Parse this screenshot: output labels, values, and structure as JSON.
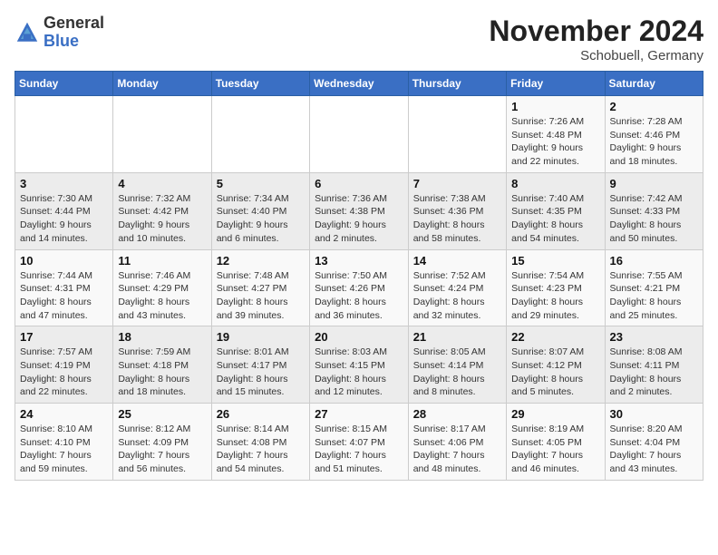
{
  "header": {
    "logo_general": "General",
    "logo_blue": "Blue",
    "month_title": "November 2024",
    "subtitle": "Schobuell, Germany"
  },
  "days_of_week": [
    "Sunday",
    "Monday",
    "Tuesday",
    "Wednesday",
    "Thursday",
    "Friday",
    "Saturday"
  ],
  "weeks": [
    [
      {
        "day": "",
        "info": ""
      },
      {
        "day": "",
        "info": ""
      },
      {
        "day": "",
        "info": ""
      },
      {
        "day": "",
        "info": ""
      },
      {
        "day": "",
        "info": ""
      },
      {
        "day": "1",
        "info": "Sunrise: 7:26 AM\nSunset: 4:48 PM\nDaylight: 9 hours\nand 22 minutes."
      },
      {
        "day": "2",
        "info": "Sunrise: 7:28 AM\nSunset: 4:46 PM\nDaylight: 9 hours\nand 18 minutes."
      }
    ],
    [
      {
        "day": "3",
        "info": "Sunrise: 7:30 AM\nSunset: 4:44 PM\nDaylight: 9 hours\nand 14 minutes."
      },
      {
        "day": "4",
        "info": "Sunrise: 7:32 AM\nSunset: 4:42 PM\nDaylight: 9 hours\nand 10 minutes."
      },
      {
        "day": "5",
        "info": "Sunrise: 7:34 AM\nSunset: 4:40 PM\nDaylight: 9 hours\nand 6 minutes."
      },
      {
        "day": "6",
        "info": "Sunrise: 7:36 AM\nSunset: 4:38 PM\nDaylight: 9 hours\nand 2 minutes."
      },
      {
        "day": "7",
        "info": "Sunrise: 7:38 AM\nSunset: 4:36 PM\nDaylight: 8 hours\nand 58 minutes."
      },
      {
        "day": "8",
        "info": "Sunrise: 7:40 AM\nSunset: 4:35 PM\nDaylight: 8 hours\nand 54 minutes."
      },
      {
        "day": "9",
        "info": "Sunrise: 7:42 AM\nSunset: 4:33 PM\nDaylight: 8 hours\nand 50 minutes."
      }
    ],
    [
      {
        "day": "10",
        "info": "Sunrise: 7:44 AM\nSunset: 4:31 PM\nDaylight: 8 hours\nand 47 minutes."
      },
      {
        "day": "11",
        "info": "Sunrise: 7:46 AM\nSunset: 4:29 PM\nDaylight: 8 hours\nand 43 minutes."
      },
      {
        "day": "12",
        "info": "Sunrise: 7:48 AM\nSunset: 4:27 PM\nDaylight: 8 hours\nand 39 minutes."
      },
      {
        "day": "13",
        "info": "Sunrise: 7:50 AM\nSunset: 4:26 PM\nDaylight: 8 hours\nand 36 minutes."
      },
      {
        "day": "14",
        "info": "Sunrise: 7:52 AM\nSunset: 4:24 PM\nDaylight: 8 hours\nand 32 minutes."
      },
      {
        "day": "15",
        "info": "Sunrise: 7:54 AM\nSunset: 4:23 PM\nDaylight: 8 hours\nand 29 minutes."
      },
      {
        "day": "16",
        "info": "Sunrise: 7:55 AM\nSunset: 4:21 PM\nDaylight: 8 hours\nand 25 minutes."
      }
    ],
    [
      {
        "day": "17",
        "info": "Sunrise: 7:57 AM\nSunset: 4:19 PM\nDaylight: 8 hours\nand 22 minutes."
      },
      {
        "day": "18",
        "info": "Sunrise: 7:59 AM\nSunset: 4:18 PM\nDaylight: 8 hours\nand 18 minutes."
      },
      {
        "day": "19",
        "info": "Sunrise: 8:01 AM\nSunset: 4:17 PM\nDaylight: 8 hours\nand 15 minutes."
      },
      {
        "day": "20",
        "info": "Sunrise: 8:03 AM\nSunset: 4:15 PM\nDaylight: 8 hours\nand 12 minutes."
      },
      {
        "day": "21",
        "info": "Sunrise: 8:05 AM\nSunset: 4:14 PM\nDaylight: 8 hours\nand 8 minutes."
      },
      {
        "day": "22",
        "info": "Sunrise: 8:07 AM\nSunset: 4:12 PM\nDaylight: 8 hours\nand 5 minutes."
      },
      {
        "day": "23",
        "info": "Sunrise: 8:08 AM\nSunset: 4:11 PM\nDaylight: 8 hours\nand 2 minutes."
      }
    ],
    [
      {
        "day": "24",
        "info": "Sunrise: 8:10 AM\nSunset: 4:10 PM\nDaylight: 7 hours\nand 59 minutes."
      },
      {
        "day": "25",
        "info": "Sunrise: 8:12 AM\nSunset: 4:09 PM\nDaylight: 7 hours\nand 56 minutes."
      },
      {
        "day": "26",
        "info": "Sunrise: 8:14 AM\nSunset: 4:08 PM\nDaylight: 7 hours\nand 54 minutes."
      },
      {
        "day": "27",
        "info": "Sunrise: 8:15 AM\nSunset: 4:07 PM\nDaylight: 7 hours\nand 51 minutes."
      },
      {
        "day": "28",
        "info": "Sunrise: 8:17 AM\nSunset: 4:06 PM\nDaylight: 7 hours\nand 48 minutes."
      },
      {
        "day": "29",
        "info": "Sunrise: 8:19 AM\nSunset: 4:05 PM\nDaylight: 7 hours\nand 46 minutes."
      },
      {
        "day": "30",
        "info": "Sunrise: 8:20 AM\nSunset: 4:04 PM\nDaylight: 7 hours\nand 43 minutes."
      }
    ]
  ]
}
